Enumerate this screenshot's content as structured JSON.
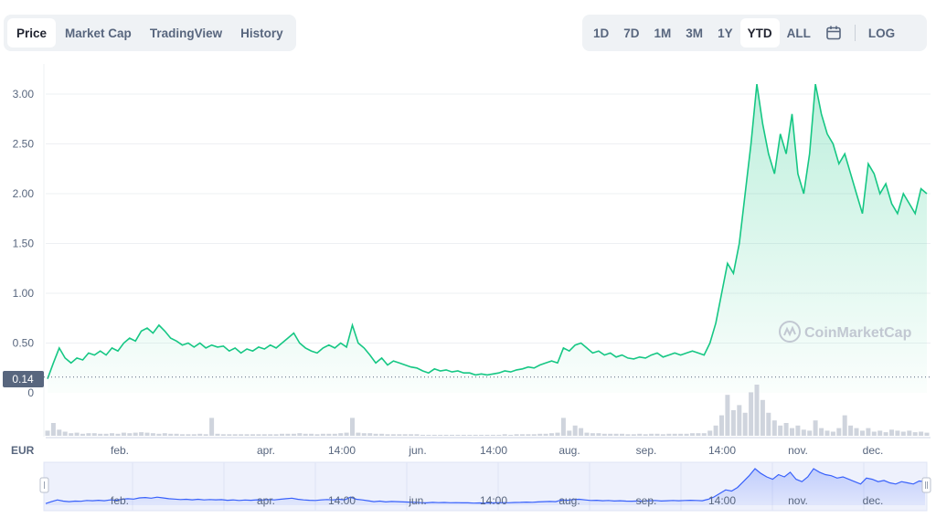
{
  "tabs": [
    {
      "label": "Price",
      "active": true
    },
    {
      "label": "Market Cap",
      "active": false
    },
    {
      "label": "TradingView",
      "active": false
    },
    {
      "label": "History",
      "active": false
    }
  ],
  "ranges": [
    {
      "label": "1D",
      "active": false
    },
    {
      "label": "7D",
      "active": false
    },
    {
      "label": "1M",
      "active": false
    },
    {
      "label": "3M",
      "active": false
    },
    {
      "label": "1Y",
      "active": false
    },
    {
      "label": "YTD",
      "active": true
    },
    {
      "label": "ALL",
      "active": false
    }
  ],
  "calendar_icon": "calendar-icon",
  "log_label": "LOG",
  "currency_label": "EUR",
  "watermark": "CoinMarketCap",
  "colors": {
    "line": "#16c784",
    "navigator": "#3861fb",
    "current": "#58667e"
  },
  "chart_data": {
    "type": "area",
    "ylim": [
      0,
      3.25
    ],
    "yticks": [
      0,
      0.5,
      1.0,
      1.5,
      2.0,
      2.5,
      3.0
    ],
    "ytick_labels": [
      "0",
      "0.50",
      "1.00",
      "1.50",
      "2.00",
      "2.50",
      "3.00"
    ],
    "current_value": 0.14,
    "current_label": "0.14",
    "xtick_labels": [
      "feb.",
      "apr.",
      "14:00",
      "jun.",
      "14:00",
      "aug.",
      "sep.",
      "14:00",
      "nov.",
      "dec."
    ],
    "series": [
      {
        "x": [
          0,
          1,
          2,
          3,
          4,
          5,
          6,
          7,
          8,
          9,
          10,
          11,
          12,
          13,
          14,
          15,
          16,
          17,
          18,
          19,
          20,
          21,
          22,
          23,
          24,
          25,
          26,
          27,
          28,
          29,
          30,
          31,
          32,
          33,
          34,
          35,
          36,
          37,
          38,
          39,
          40,
          41,
          42,
          43,
          44,
          45,
          46,
          47,
          48,
          49,
          50,
          51,
          52,
          53,
          54,
          55,
          56,
          57,
          58,
          59,
          60,
          61,
          62,
          63,
          64,
          65,
          66,
          67,
          68,
          69,
          70,
          71,
          72,
          73,
          74,
          75,
          76,
          77,
          78,
          79,
          80,
          81,
          82,
          83,
          84,
          85,
          86,
          87,
          88,
          89,
          90,
          91,
          92,
          93,
          94,
          95,
          96,
          97,
          98,
          99,
          100,
          101,
          102,
          103,
          104,
          105,
          106,
          107,
          108,
          109,
          110,
          111,
          112,
          113,
          114,
          115,
          116,
          117,
          118,
          119,
          120,
          121,
          122,
          123,
          124,
          125,
          126,
          127,
          128,
          129,
          130,
          131,
          132,
          133,
          134,
          135,
          136,
          137,
          138,
          139,
          140,
          141,
          142,
          143,
          144,
          145,
          146,
          147,
          148,
          149,
          150
        ],
        "values": [
          0.14,
          0.3,
          0.45,
          0.35,
          0.3,
          0.35,
          0.33,
          0.4,
          0.38,
          0.42,
          0.38,
          0.45,
          0.42,
          0.5,
          0.55,
          0.52,
          0.62,
          0.65,
          0.6,
          0.68,
          0.62,
          0.55,
          0.52,
          0.48,
          0.5,
          0.46,
          0.5,
          0.45,
          0.48,
          0.46,
          0.47,
          0.42,
          0.45,
          0.4,
          0.44,
          0.42,
          0.46,
          0.44,
          0.48,
          0.45,
          0.5,
          0.55,
          0.6,
          0.5,
          0.45,
          0.42,
          0.4,
          0.45,
          0.48,
          0.45,
          0.5,
          0.46,
          0.68,
          0.5,
          0.45,
          0.38,
          0.3,
          0.35,
          0.28,
          0.32,
          0.3,
          0.28,
          0.26,
          0.25,
          0.22,
          0.2,
          0.24,
          0.22,
          0.23,
          0.21,
          0.22,
          0.2,
          0.2,
          0.18,
          0.19,
          0.18,
          0.19,
          0.2,
          0.22,
          0.21,
          0.23,
          0.24,
          0.26,
          0.25,
          0.28,
          0.3,
          0.32,
          0.3,
          0.45,
          0.42,
          0.48,
          0.5,
          0.45,
          0.4,
          0.42,
          0.38,
          0.4,
          0.36,
          0.38,
          0.35,
          0.34,
          0.36,
          0.35,
          0.38,
          0.4,
          0.36,
          0.38,
          0.4,
          0.38,
          0.4,
          0.42,
          0.4,
          0.38,
          0.5,
          0.7,
          1.0,
          1.3,
          1.2,
          1.5,
          2.0,
          2.5,
          3.1,
          2.7,
          2.4,
          2.2,
          2.6,
          2.4,
          2.8,
          2.2,
          2.0,
          2.4,
          3.1,
          2.8,
          2.6,
          2.5,
          2.3,
          2.4,
          2.2,
          2.0,
          1.8,
          2.3,
          2.2,
          2.0,
          2.1,
          1.9,
          1.8,
          2.0,
          1.9,
          1.8,
          2.05,
          2.0
        ]
      }
    ],
    "volume_series": {
      "values": [
        0.1,
        0.25,
        0.12,
        0.08,
        0.05,
        0.06,
        0.04,
        0.05,
        0.05,
        0.04,
        0.04,
        0.05,
        0.04,
        0.06,
        0.05,
        0.06,
        0.07,
        0.06,
        0.05,
        0.04,
        0.05,
        0.04,
        0.04,
        0.03,
        0.03,
        0.03,
        0.04,
        0.03,
        0.35,
        0.04,
        0.03,
        0.03,
        0.03,
        0.03,
        0.03,
        0.03,
        0.03,
        0.03,
        0.03,
        0.03,
        0.04,
        0.04,
        0.04,
        0.05,
        0.04,
        0.04,
        0.03,
        0.04,
        0.04,
        0.04,
        0.05,
        0.06,
        0.35,
        0.06,
        0.05,
        0.05,
        0.04,
        0.04,
        0.03,
        0.03,
        0.03,
        0.03,
        0.03,
        0.03,
        0.02,
        0.02,
        0.02,
        0.02,
        0.02,
        0.02,
        0.02,
        0.02,
        0.02,
        0.02,
        0.02,
        0.02,
        0.02,
        0.02,
        0.03,
        0.02,
        0.03,
        0.03,
        0.03,
        0.03,
        0.04,
        0.04,
        0.05,
        0.06,
        0.35,
        0.1,
        0.2,
        0.15,
        0.06,
        0.05,
        0.05,
        0.04,
        0.04,
        0.04,
        0.04,
        0.03,
        0.03,
        0.04,
        0.03,
        0.04,
        0.04,
        0.03,
        0.04,
        0.04,
        0.04,
        0.04,
        0.05,
        0.05,
        0.05,
        0.1,
        0.2,
        0.4,
        0.8,
        0.5,
        0.6,
        0.45,
        0.85,
        1.0,
        0.7,
        0.45,
        0.3,
        0.2,
        0.25,
        0.15,
        0.2,
        0.12,
        0.1,
        0.3,
        0.15,
        0.1,
        0.08,
        0.15,
        0.4,
        0.2,
        0.15,
        0.1,
        0.15,
        0.08,
        0.1,
        0.07,
        0.12,
        0.1,
        0.08,
        0.1,
        0.07,
        0.08,
        0.06
      ]
    }
  }
}
